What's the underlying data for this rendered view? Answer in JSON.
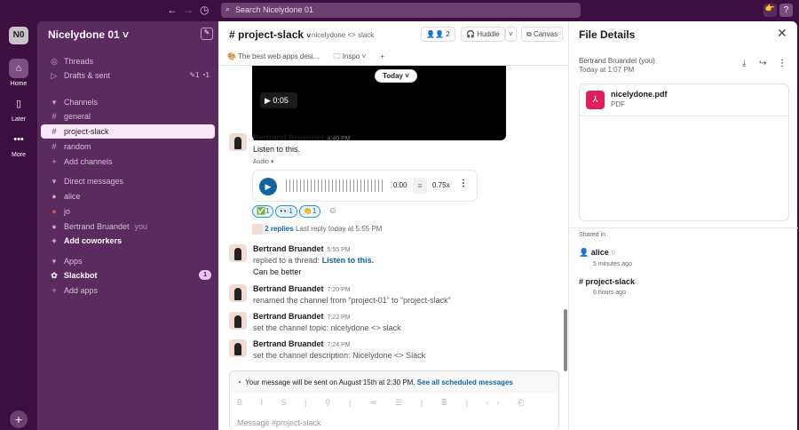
{
  "topbar": {
    "search_placeholder": "Search Nicelydone 01"
  },
  "rail": {
    "workspace": "N0",
    "items": [
      {
        "label": "Home"
      },
      {
        "label": "Later"
      },
      {
        "label": "More"
      }
    ]
  },
  "sidebar": {
    "workspace_name": "Nicelydone 01",
    "threads": "Threads",
    "drafts": "Drafts & sent",
    "drafts_count": "1",
    "scheduled_count": "1",
    "channels_header": "Channels",
    "channels": [
      "general",
      "project-slack",
      "random"
    ],
    "add_channels": "Add channels",
    "dm_header": "Direct messages",
    "dms": [
      {
        "name": "alice"
      },
      {
        "name": "jo"
      },
      {
        "name": "Bertrand Bruandet",
        "suffix": "you"
      }
    ],
    "add_coworkers": "Add coworkers",
    "apps_header": "Apps",
    "app": "Slackbot",
    "app_badge": "1",
    "add_apps": "Add apps"
  },
  "channel": {
    "name": "# project-slack",
    "topic": "nicelydone <> slack",
    "member_count": "2",
    "huddle": "Huddle",
    "canvas": "Canvas",
    "bookmarks": [
      {
        "label": "The best web apps desi..."
      },
      {
        "label": "Inspo"
      }
    ],
    "date_pill": "Today",
    "video_time": "0:05"
  },
  "messages": [
    {
      "author": "Bertrand Bruandet",
      "time": "4:40 PM",
      "text": "Listen to this.",
      "audio_label": "Audio",
      "audio_time": "0:00",
      "audio_speed": "0.75x",
      "reactions": [
        {
          "emoji": "✅",
          "count": "1"
        },
        {
          "emoji": "👀",
          "count": "1"
        },
        {
          "emoji": "👏",
          "count": "1"
        }
      ],
      "replies": "2 replies",
      "last_reply": "Last reply today at 5:55 PM"
    },
    {
      "author": "Bertrand Bruandet",
      "time": "5:55 PM",
      "prefix": "replied to a thread:",
      "link": "Listen to this.",
      "text": "Can be better"
    },
    {
      "author": "Bertrand Bruandet",
      "time": "7:20 PM",
      "text": "renamed the channel from “project-01” to “project-slack”"
    },
    {
      "author": "Bertrand Bruandet",
      "time": "7:22 PM",
      "text": "set the channel topic: nicelydone <> slack"
    },
    {
      "author": "Bertrand Bruandet",
      "time": "7:24 PM",
      "text": "set the channel description: Nicelydone <> Slack"
    }
  ],
  "composer": {
    "scheduled": "Your message will be sent on August 15th at 2:30 PM.",
    "scheduled_link": "See all scheduled messages",
    "placeholder": "Message #project-slack"
  },
  "details": {
    "title": "File Details",
    "owner": "Bertrand Bruandet (you)",
    "date": "Today at 1:07 PM",
    "file_name": "nicelydone.pdf",
    "file_type": "PDF",
    "shared_in": "Shared in",
    "shares": [
      {
        "name": "alice",
        "time": "5 minutes ago"
      },
      {
        "name": "project-slack",
        "time": "6 hours ago"
      }
    ]
  }
}
